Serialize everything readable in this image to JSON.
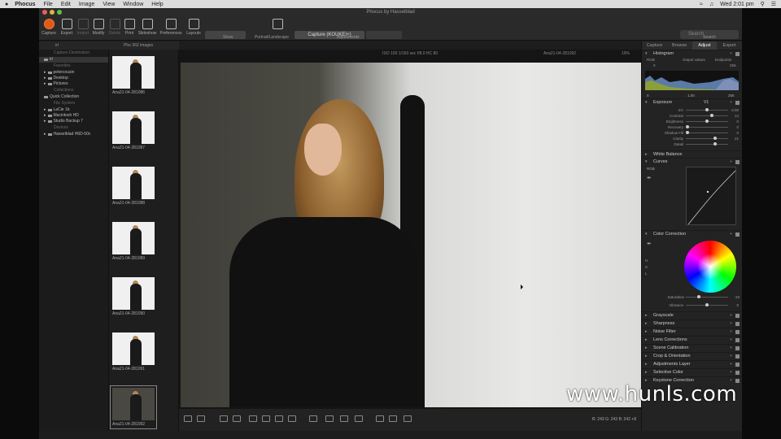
{
  "menubar": {
    "app": "Phocus",
    "items": [
      "File",
      "Edit",
      "Image",
      "View",
      "Window",
      "Help"
    ],
    "clock": "Wed 2:01 pm"
  },
  "window": {
    "title": "Phocus by Hasselblad"
  },
  "toolbar": {
    "buttons": [
      "Capture",
      "Export",
      "Import",
      "Modify",
      "Delete",
      "Print",
      "Slideshow",
      "Preferences",
      "Layouts"
    ],
    "show_label": "Show",
    "portrait_label": "Portrait/Landscape",
    "capture_select": "Capture (KOUKEI+)",
    "adjustments_label": "Adjustments",
    "search_placeholder": "Search",
    "search_label": "Search"
  },
  "browser_header": {
    "images": "Pho 362 images",
    "path": "irl"
  },
  "left_panel": {
    "capture_destination": "Capture Destination",
    "destination_item": "irl",
    "favorites_header": "Favorites",
    "favorites": [
      "petercousin",
      "Desktop",
      "Pictures"
    ],
    "collections_header": "Collections",
    "collections": [
      "Quick Collection"
    ],
    "filesystem_header": "File System",
    "filesystem": [
      "LaCie 1b",
      "Macintosh HD",
      "Studio Backup 7"
    ],
    "devices_header": "Devices",
    "devices": [
      "Hasselblad H6D-50c"
    ]
  },
  "thumbnails": [
    {
      "name": "Ana21-04-281086"
    },
    {
      "name": "Ana21-04-281087"
    },
    {
      "name": "Ana21-04-281088"
    },
    {
      "name": "Ana21-04-281089"
    },
    {
      "name": "Ana21-04-281090"
    },
    {
      "name": "Ana21-04-281091"
    },
    {
      "name": "Ana21-04-281092"
    }
  ],
  "viewer": {
    "exif": "ISO 100   1/160 sec   f/8.0   HC 80",
    "filename": "Ana21-04-281092",
    "zoom": "19%",
    "rgb_readout": "R: 243   G: 243   B: 242   +8"
  },
  "right_panel": {
    "tabs": [
      "Capture",
      "Browse",
      "Adjust",
      "Export"
    ],
    "active_tab": "Adjust",
    "histogram": {
      "title": "Histogram",
      "channel": "RGB",
      "output_values": "Output values",
      "endpoints": "Endpoints",
      "low": "0",
      "high": "255",
      "mid": "1.00",
      "low2": "0",
      "high2": "255"
    },
    "exposure": {
      "title": "Exposure",
      "preset": "V1",
      "sliders": [
        {
          "label": "EV",
          "value": "0.00",
          "pos": 0.5
        },
        {
          "label": "Contrast",
          "value": "14",
          "pos": 0.62
        },
        {
          "label": "Brightness",
          "value": "0",
          "pos": 0.5
        },
        {
          "label": "Recovery",
          "value": "0",
          "pos": 0.0
        },
        {
          "label": "Shadow Fill",
          "value": "0",
          "pos": 0.0
        },
        {
          "label": "Clarity",
          "value": "21",
          "pos": 0.7
        },
        {
          "label": "Detail",
          "value": "",
          "pos": 0.7
        }
      ]
    },
    "white_balance": "White Balance",
    "curves": {
      "title": "Curves",
      "channel": "RGB"
    },
    "color_correction": {
      "title": "Color Correction",
      "h": "H",
      "s": "S",
      "l": "L",
      "saturation_label": "Saturation",
      "saturation_value": "-18",
      "vibrance_label": "Vibrance",
      "vibrance_value": "0"
    },
    "tools": [
      "Grayscale",
      "Sharpness",
      "Noise Filter",
      "Lens Corrections",
      "Scene Calibration",
      "Crop & Orientation",
      "Adjustments Layer",
      "Selective Color",
      "Keystone Correction"
    ]
  },
  "watermark": "www.hunls.com"
}
